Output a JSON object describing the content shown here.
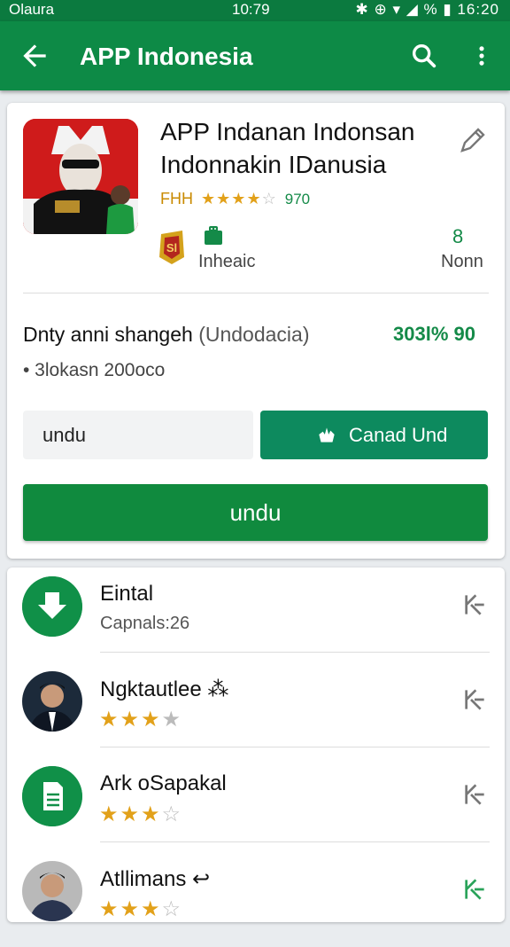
{
  "status_bar": {
    "left": "Olaura",
    "time": "10:79",
    "right": "✱ ⊕ ▾ ◢ % ▮ 16:20"
  },
  "app_bar": {
    "title": "APP Indonesia"
  },
  "app": {
    "name": "APP Indanan Indonsan Indonnakin IDanusia",
    "rating_label": "FHH",
    "rating": 3.5,
    "rating_count": "970",
    "info_label": "Inheaic",
    "stat_value": "8",
    "stat_label": "Nonn",
    "description": "Dnty anni shangeh",
    "description_sub": "(Undodacia)",
    "percent": "303l% 90",
    "size": "• 3lokasn  200oco"
  },
  "buttons": {
    "secondary_label": "undu",
    "cancel_label": "Canad Und",
    "primary_label": "undu"
  },
  "list": [
    {
      "title": "Eintal",
      "subtitle": "Capnals:26",
      "avatar": "download-icon",
      "rating": null
    },
    {
      "title": "Ngktautlee ⁂",
      "subtitle": "",
      "avatar": "person-avatar",
      "rating": 3
    },
    {
      "title": "Ark oSapakal",
      "subtitle": "",
      "avatar": "document-icon",
      "rating": 3
    },
    {
      "title": "Atllimans ↩",
      "subtitle": "",
      "avatar": "person-avatar",
      "rating": 3
    }
  ],
  "colors": {
    "primary": "#0d8a46",
    "accent": "#148a48",
    "star": "#e2a11a"
  }
}
